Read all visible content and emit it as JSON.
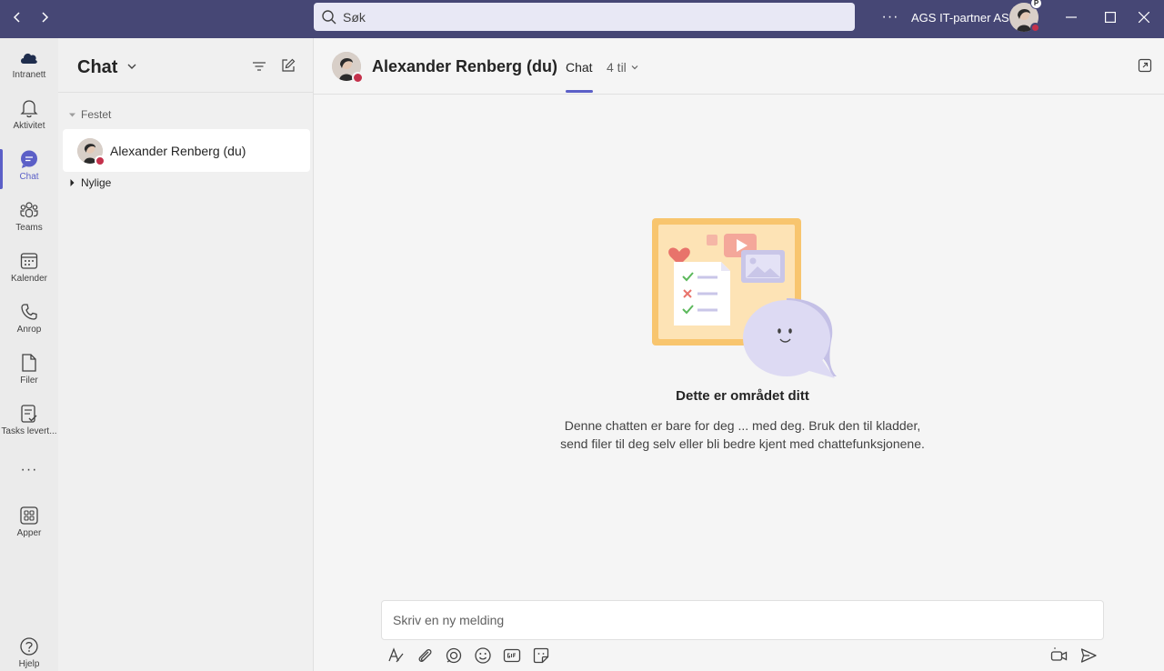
{
  "titlebar": {
    "back_icon": "chevron-left-icon",
    "forward_icon": "chevron-right-icon",
    "search_placeholder": "Søk",
    "more_label": "···",
    "org_name": "AGS IT-partner AS",
    "profile_badge": "P",
    "status_color": "#c4314b",
    "bar_color": "#464775"
  },
  "rail": {
    "items": [
      {
        "label": "Intranett",
        "icon": "cloud-icon"
      },
      {
        "label": "Aktivitet",
        "icon": "bell-icon"
      },
      {
        "label": "Chat",
        "icon": "chat-icon",
        "active": true
      },
      {
        "label": "Teams",
        "icon": "teams-icon"
      },
      {
        "label": "Kalender",
        "icon": "calendar-icon"
      },
      {
        "label": "Anrop",
        "icon": "phone-icon"
      },
      {
        "label": "Filer",
        "icon": "file-icon"
      },
      {
        "label": "Tasks levert...",
        "icon": "tasks-icon"
      },
      {
        "label": "···",
        "icon": "more-icon"
      },
      {
        "label": "Apper",
        "icon": "apps-icon"
      },
      {
        "label": "Hjelp",
        "icon": "help-icon"
      }
    ],
    "accent": "#5b5fc7"
  },
  "listpane": {
    "title": "Chat",
    "sections": {
      "pinned": "Festet",
      "recent": "Nylige"
    },
    "chats": [
      {
        "name": "Alexander Renberg (du)"
      }
    ]
  },
  "main": {
    "contact_name": "Alexander Renberg (du)",
    "tab_chat": "Chat",
    "participants": "4 til",
    "empty_title": "Dette er området ditt",
    "empty_desc": "Denne chatten er bare for deg ... med deg. Bruk den til kladder, send filer til deg selv eller bli bedre kjent med chattefunksjonene.",
    "compose_placeholder": "Skriv en ny melding"
  }
}
